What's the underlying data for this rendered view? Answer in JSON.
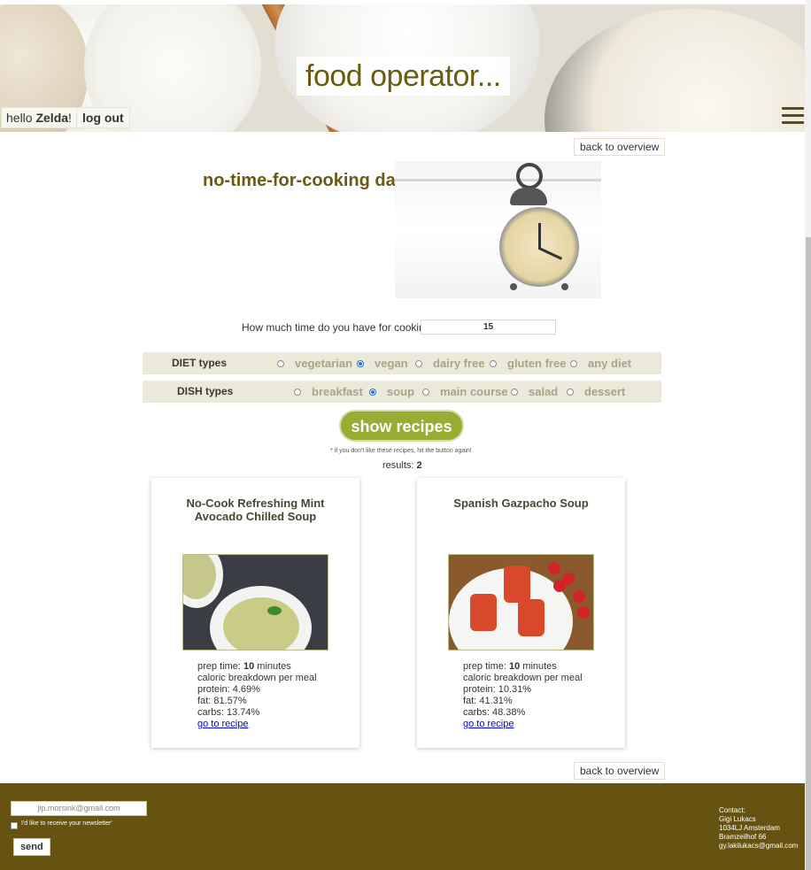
{
  "header": {
    "brand": "food operator...",
    "greeting_prefix": "hello ",
    "user_name": "Zelda",
    "greeting_suffix": "!",
    "logout_label": "log out"
  },
  "nav": {
    "back_label": "back to overview"
  },
  "page": {
    "title": "no-time-for-cooking day"
  },
  "time_question": {
    "label": "How much time do you have for cooking?",
    "value": "15"
  },
  "diet": {
    "label": "DIET types",
    "options": [
      "vegetarian",
      "vegan",
      "dairy free",
      "gluten free",
      "any diet"
    ],
    "selected": "vegan"
  },
  "dish": {
    "label": "DISH types",
    "options": [
      "breakfast",
      "soup",
      "main course",
      "salad",
      "dessert"
    ],
    "selected": "soup"
  },
  "action": {
    "show_label": "show recipes",
    "hint": "* if you don't like these recipes, hit the button again!"
  },
  "results": {
    "label": "results: ",
    "count": "2"
  },
  "recipes": [
    {
      "title": "No-Cook Refreshing Mint Avocado Chilled Soup",
      "prep_prefix": "prep time: ",
      "prep_value": "10",
      "prep_suffix": " minutes",
      "breakdown_label": "caloric breakdown per meal",
      "protein": "protein: 4.69%",
      "fat": "fat: 81.57%",
      "carbs": "carbs: 13.74%",
      "link": "go to recipe"
    },
    {
      "title": "Spanish Gazpacho Soup",
      "prep_prefix": "prep time: ",
      "prep_value": "10",
      "prep_suffix": " minutes",
      "breakdown_label": "caloric breakdown per meal",
      "protein": "protein: 10.31%",
      "fat": "fat: 41.31%",
      "carbs": "carbs: 48.38%",
      "link": "go to recipe"
    }
  ],
  "footer": {
    "newsletter_placeholder": "jip.morsink@gmail.com",
    "newsletter_checkbox_label": "I'd like to receive your newsletter'",
    "send_label": "send",
    "contact_title": "Contact:",
    "contact_name": "Gigi Lukacs",
    "contact_city": "1034LJ Amsterdam",
    "contact_street": "Bramzeilhof 66",
    "contact_email": "gy.lakilukacs@gmail.com"
  },
  "colors": {
    "brand_olive": "#6a5a12",
    "footer_bg": "#665311",
    "button_green": "#9bac33",
    "band_bg": "#ebe9d9"
  }
}
